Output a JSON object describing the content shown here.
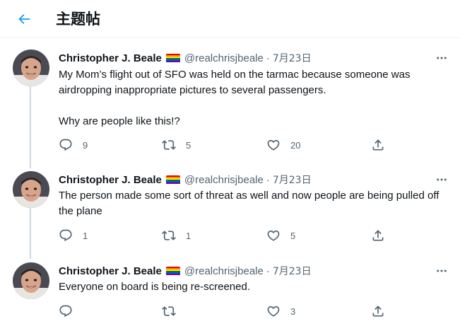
{
  "header": {
    "title": "主题帖",
    "back_icon": "arrow-left-icon",
    "accent": "#1d9bf0"
  },
  "tweets": [
    {
      "author": "Christopher J. Beale",
      "handle": "@realchrisjbeale",
      "separator": "·",
      "date": "7月23日",
      "text_lines": [
        "My Mom’s flight out of SFO was held on the tarmac because someone was airdropping inappropriate pictures to several passengers.",
        "Why are people like this!?"
      ],
      "replies": "9",
      "retweets": "5",
      "likes": "20"
    },
    {
      "author": "Christopher J. Beale",
      "handle": "@realchrisjbeale",
      "separator": "·",
      "date": "7月23日",
      "text_lines": [
        "The person made some sort of threat as well and now people are being pulled off the plane"
      ],
      "replies": "1",
      "retweets": "1",
      "likes": "5"
    },
    {
      "author": "Christopher J. Beale",
      "handle": "@realchrisjbeale",
      "separator": "·",
      "date": "7月23日",
      "text_lines": [
        "Everyone on board is being re-screened."
      ],
      "replies": "",
      "retweets": "",
      "likes": "3"
    }
  ],
  "colors": {
    "text": "#0f1419",
    "secondary": "#536471",
    "thread_line": "#cfd9de",
    "divider": "#eff3f4"
  },
  "icons": [
    "rainbow-flag-icon",
    "more-icon",
    "reply-icon",
    "retweet-icon",
    "like-icon",
    "share-icon"
  ]
}
